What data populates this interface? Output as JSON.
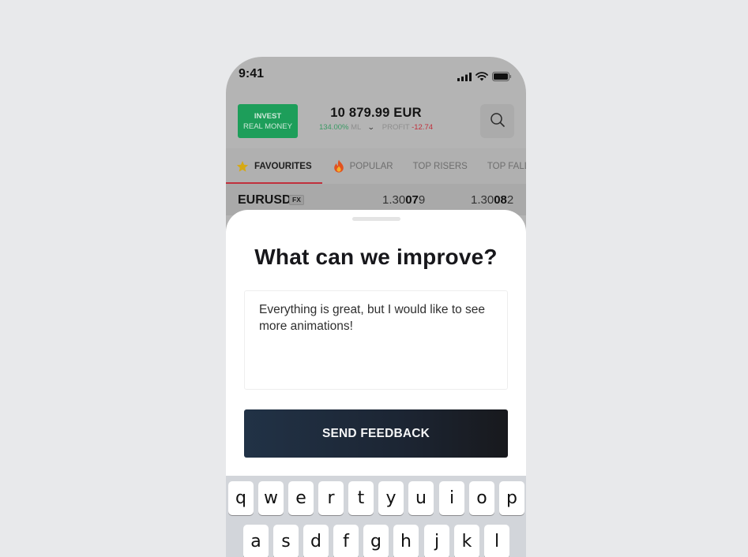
{
  "status_bar": {
    "time": "9:41",
    "icons": [
      "cellular-signal-icon",
      "wifi-icon",
      "battery-icon"
    ]
  },
  "header": {
    "invest_button": {
      "line1": "INVEST",
      "line2": "REAL MONEY"
    },
    "balance": "10 879.99 EUR",
    "margin_level": "134.00%",
    "margin_label": "ML",
    "profit_label": "PROFIT",
    "profit_value": "-12.74",
    "search_icon": "search-icon"
  },
  "tabs": [
    {
      "label": "FAVOURITES",
      "icon": "star-icon",
      "active": true
    },
    {
      "label": "POPULAR",
      "icon": "fire-icon",
      "active": false
    },
    {
      "label": "TOP RISERS",
      "active": false
    },
    {
      "label": "TOP FALLERS",
      "active": false
    }
  ],
  "instrument": {
    "symbol": "EURUSD",
    "badge": "FX",
    "bid": {
      "prefix": "1.30",
      "big": "07",
      "suffix": "9"
    },
    "ask": {
      "prefix": "1.30",
      "big": "08",
      "suffix": "2"
    }
  },
  "feedback_sheet": {
    "title": "What can we improve?",
    "input_value": "Everything is great, but I would like to see more animations!",
    "send_label": "SEND FEEDBACK"
  },
  "keyboard": {
    "row1": [
      "q",
      "w",
      "e",
      "r",
      "t",
      "y",
      "u",
      "i",
      "o",
      "p"
    ],
    "row2": [
      "a",
      "s",
      "d",
      "f",
      "g",
      "h",
      "j",
      "k",
      "l"
    ]
  },
  "colors": {
    "invest_green": "#1d9e5a",
    "profit_negative": "#c0303c",
    "ml_positive": "#3b9a65",
    "tab_indicator": "#c0303c",
    "send_button": "#1f2c3c"
  }
}
